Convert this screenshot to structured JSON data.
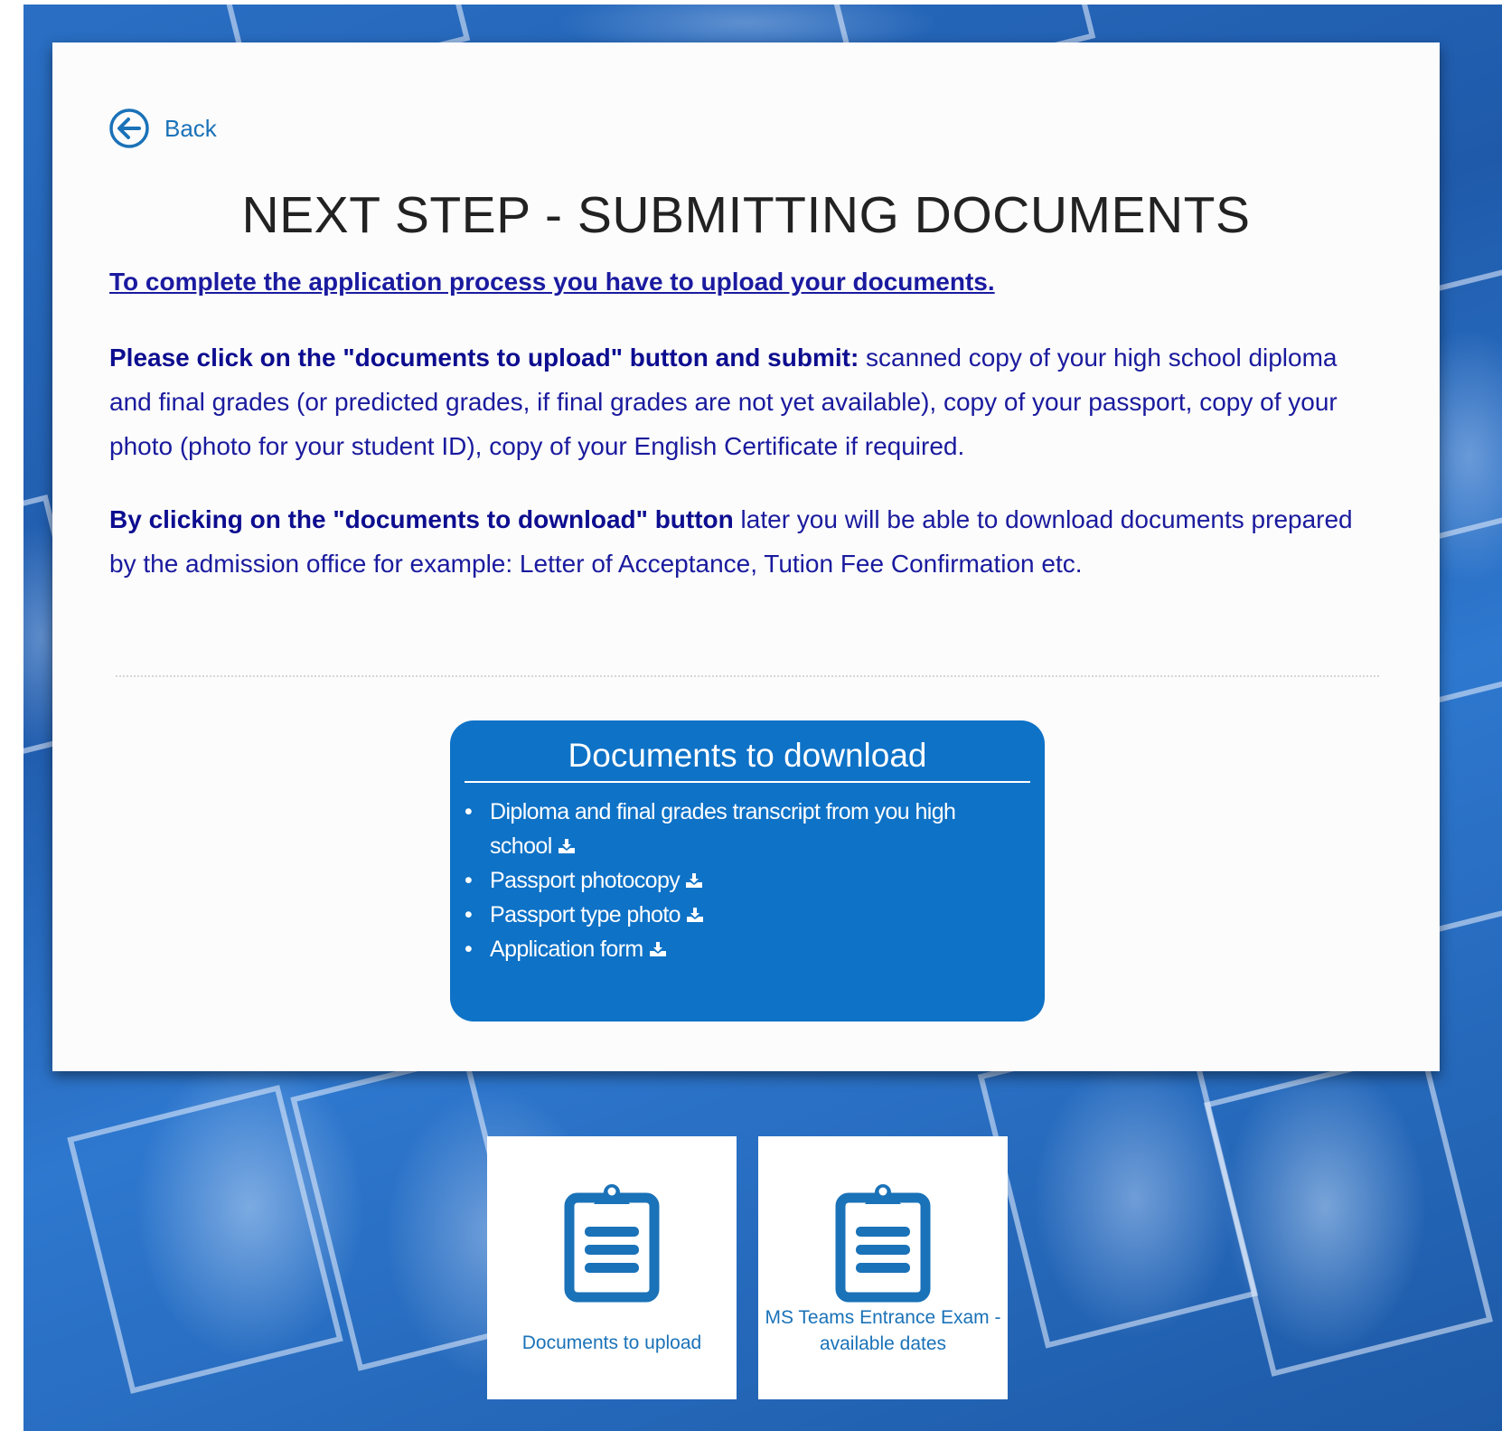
{
  "back": {
    "label": "Back"
  },
  "page": {
    "title": "NEXT STEP - SUBMITTING DOCUMENTS",
    "intro_link": "To complete the application process you have to upload your documents.",
    "para1_bold": "Please click on the \"documents to upload\" button and submit:",
    "para1_text": " scanned copy of your high school diploma and final grades (or predicted grades, if final grades are not yet available), copy of your passport, copy of your photo (photo for your student ID), copy of your English Certificate if required.",
    "para2_bold": "By clicking on the \"documents to download\" button",
    "para2_text": " later you will be able to download documents prepared by the admission office for example: Letter of Acceptance, Tution Fee Confirmation etc."
  },
  "downloads": {
    "title": "Documents to download",
    "items": [
      {
        "label": "Diploma and final grades transcript from you high school",
        "icon": "download-icon"
      },
      {
        "label": "Passport photocopy",
        "icon": "download-icon"
      },
      {
        "label": "Passport type photo",
        "icon": "download-icon"
      },
      {
        "label": "Application form",
        "icon": "download-icon"
      }
    ]
  },
  "tiles": [
    {
      "label": "Documents to upload",
      "icon": "clipboard-icon"
    },
    {
      "label": "MS Teams Entrance Exam - available dates",
      "icon": "clipboard-icon"
    }
  ],
  "colors": {
    "accent": "#1a72b8",
    "panel": "#0e72c7",
    "body_text": "#1a1a9e",
    "background": "#2266bb"
  }
}
